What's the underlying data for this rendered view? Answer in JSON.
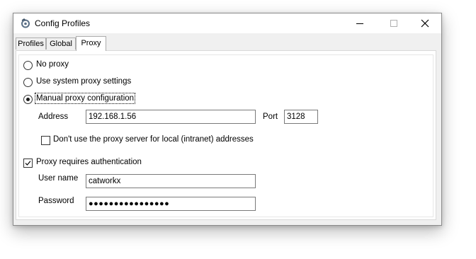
{
  "window": {
    "title": "Config Profiles"
  },
  "tabs": [
    {
      "label": "Profiles"
    },
    {
      "label": "Global"
    },
    {
      "label": "Proxy"
    }
  ],
  "proxy": {
    "options": [
      {
        "label": "No proxy",
        "selected": false
      },
      {
        "label": "Use system proxy settings",
        "selected": false
      },
      {
        "label": "Manual proxy configuration",
        "selected": true
      }
    ],
    "address_label": "Address",
    "address_value": "192.168.1.56",
    "port_label": "Port",
    "port_value": "3128",
    "no_local_label": "Don't use the proxy server for local (intranet) addresses",
    "no_local_checked": false,
    "auth_label": "Proxy requires authentication",
    "auth_checked": true,
    "username_label": "User name",
    "username_value": "catworkx",
    "password_label": "Password",
    "password_masked": "●●●●●●●●●●●●●●●●"
  },
  "colors": {
    "window_bg": "#f0f0f0",
    "panel_bg": "#ffffff",
    "border": "#7a7a7a"
  },
  "icons": [
    "app-icon",
    "minimize-icon",
    "maximize-icon",
    "close-icon",
    "checkmark-icon"
  ]
}
